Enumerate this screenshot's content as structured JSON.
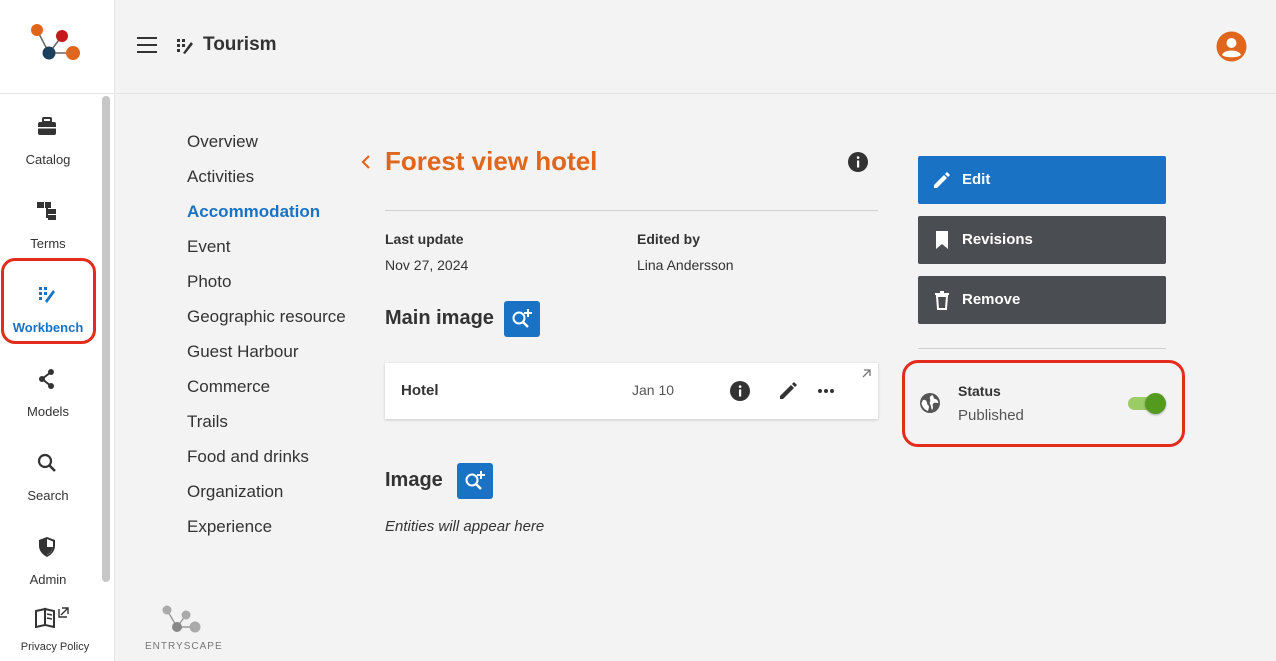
{
  "brand": {
    "name": "ENTRYSCAPE",
    "colors": {
      "orange": "#e0661c",
      "red": "#c21b1b",
      "navy": "#1d3f5e"
    }
  },
  "rail": {
    "items": [
      {
        "label": "Catalog",
        "icon": "briefcase-icon"
      },
      {
        "label": "Terms",
        "icon": "hierarchy-icon"
      },
      {
        "label": "Workbench",
        "icon": "workbench-icon",
        "active": true
      },
      {
        "label": "Models",
        "icon": "share-nodes-icon"
      },
      {
        "label": "Search",
        "icon": "search-icon"
      },
      {
        "label": "Admin",
        "icon": "shield-icon"
      }
    ],
    "privacy_label": "Privacy Policy"
  },
  "header": {
    "context_title": "Tourism"
  },
  "subnav": {
    "items": [
      {
        "label": "Overview"
      },
      {
        "label": "Activities"
      },
      {
        "label": "Accommodation",
        "active": true
      },
      {
        "label": "Event"
      },
      {
        "label": "Photo"
      },
      {
        "label": "Geographic resource"
      },
      {
        "label": "Guest Harbour"
      },
      {
        "label": "Commerce"
      },
      {
        "label": "Trails"
      },
      {
        "label": "Food and drinks"
      },
      {
        "label": "Organization"
      },
      {
        "label": "Experience"
      }
    ]
  },
  "entity": {
    "title": "Forest view hotel",
    "last_update_label": "Last update",
    "last_update_value": "Nov 27, 2024",
    "edited_by_label": "Edited by",
    "edited_by_value": "Lina Andersson"
  },
  "main_image": {
    "title": "Main image",
    "item": {
      "name": "Hotel",
      "date": "Jan 10"
    }
  },
  "image": {
    "title": "Image",
    "empty_text": "Entities will appear here"
  },
  "actions": {
    "edit": "Edit",
    "revisions": "Revisions",
    "remove": "Remove"
  },
  "status": {
    "label": "Status",
    "value": "Published",
    "enabled": true
  }
}
